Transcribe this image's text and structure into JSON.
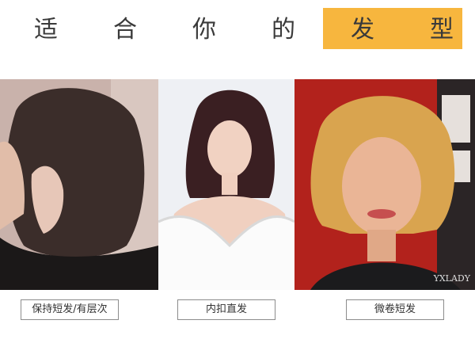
{
  "title": {
    "chars": [
      "适",
      "合",
      "你",
      "的",
      "发",
      "型"
    ],
    "highlight_color": "#f7b63e",
    "text_color": "#3a3a3a"
  },
  "photos": [
    {
      "label": "保持短发/有层次",
      "description_icon": "woman-short-layered-hair-photo"
    },
    {
      "label": "内扣直发",
      "description_icon": "woman-straight-inward-bob-photo"
    },
    {
      "label": "微卷短发",
      "description_icon": "woman-wavy-short-bob-photo",
      "watermark": "YXLADY"
    }
  ]
}
